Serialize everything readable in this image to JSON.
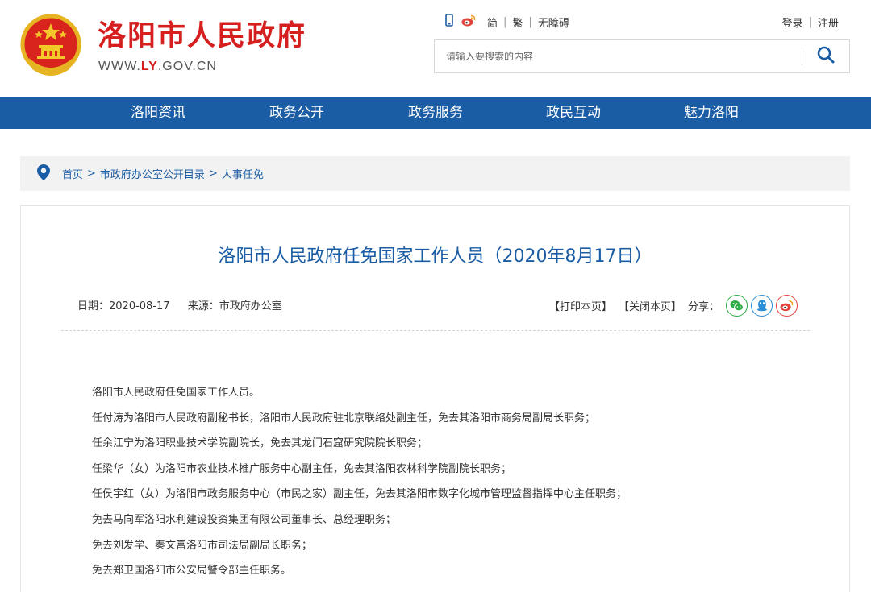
{
  "header": {
    "site_title": "洛阳市人民政府",
    "domain_prefix": "WWW.",
    "domain_highlight": "LY",
    "domain_suffix": ".GOV.CN",
    "tools": {
      "simplified": "简",
      "traditional": "繁",
      "accessibility": "无障碍"
    },
    "auth": {
      "login": "登录",
      "register": "注册"
    },
    "search": {
      "placeholder": "请输入要搜索的内容"
    }
  },
  "nav": {
    "items": [
      "洛阳资讯",
      "政务公开",
      "政务服务",
      "政民互动",
      "魅力洛阳"
    ]
  },
  "breadcrumb": {
    "items": [
      "首页",
      "市政府办公室公开目录",
      "人事任免"
    ],
    "separator": ">"
  },
  "article": {
    "title": "洛阳市人民政府任免国家工作人员（2020年8月17日）",
    "date": "日期：2020-08-17",
    "source": "来源：市政府办公室",
    "print_label": "【打印本页】",
    "close_label": "【关闭本页】",
    "share_label": "分享：",
    "paragraphs": [
      "洛阳市人民政府任免国家工作人员。",
      "任付涛为洛阳市人民政府副秘书长，洛阳市人民政府驻北京联络处副主任，免去其洛阳市商务局副局长职务；",
      "任余江宁为洛阳职业技术学院副院长，免去其龙门石窟研究院院长职务；",
      "任梁华（女）为洛阳市农业技术推广服务中心副主任，免去其洛阳农林科学院副院长职务；",
      "任侯宇红（女）为洛阳市政务服务中心（市民之家）副主任，免去其洛阳市数字化城市管理监督指挥中心主任职务；",
      "免去马向军洛阳水利建设投资集团有限公司董事长、总经理职务；",
      "免去刘发学、秦文富洛阳市司法局副局长职务；",
      "免去郑卫国洛阳市公安局警令部主任职务。"
    ]
  },
  "colors": {
    "brand_red": "#d61f1f",
    "nav_blue": "#1b5da4",
    "wechat_green": "#2dae45",
    "qq_blue": "#2a8fd8",
    "weibo_red": "#e2443d"
  },
  "icons": [
    "national-emblem-icon",
    "mobile-icon",
    "weibo-icon",
    "search-icon",
    "location-pin-icon",
    "wechat-icon",
    "qq-icon",
    "weibo-share-icon"
  ]
}
